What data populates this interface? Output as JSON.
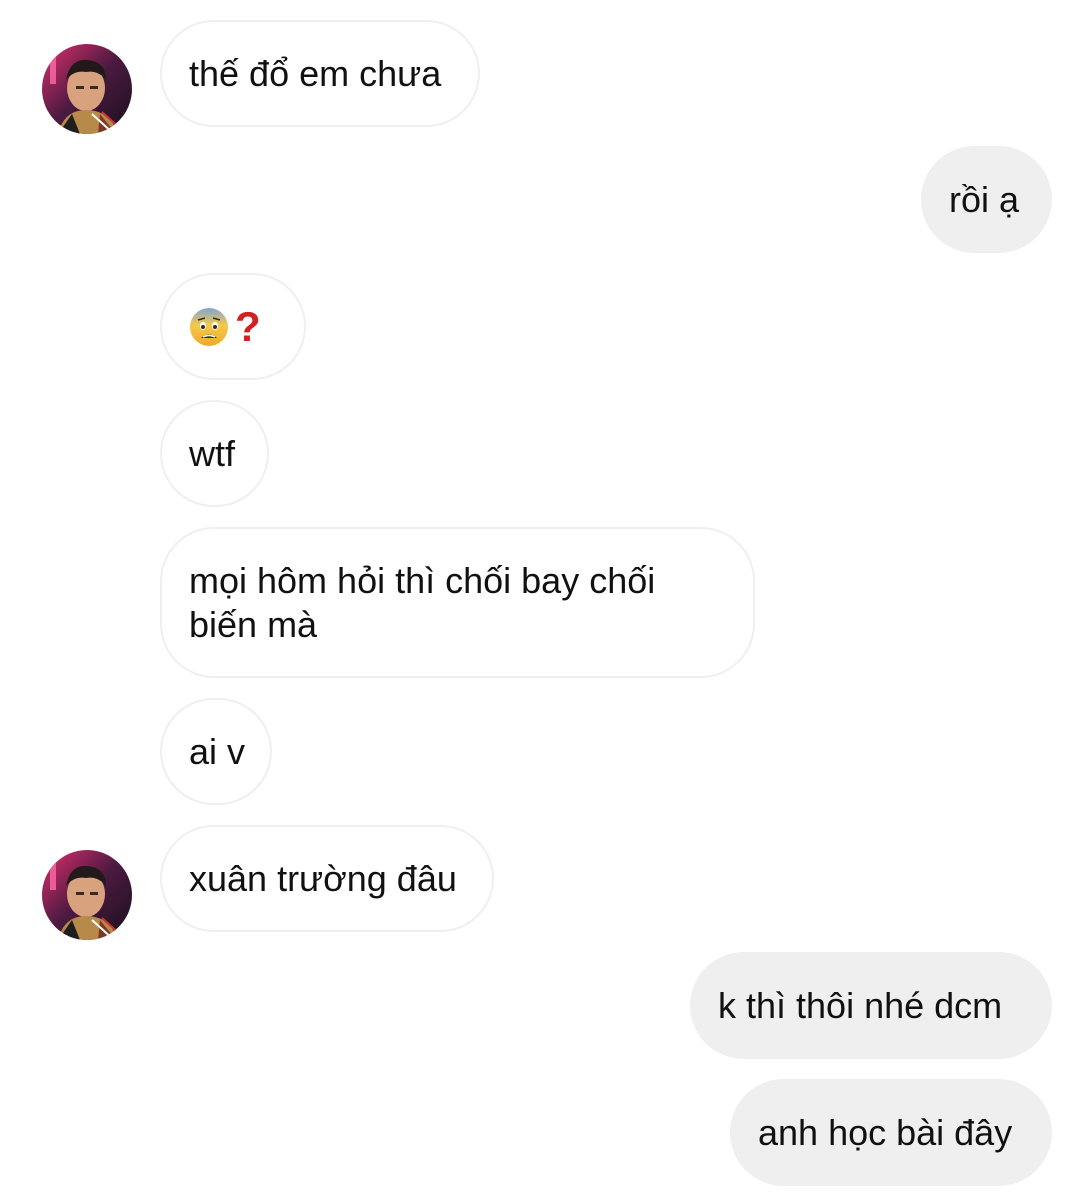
{
  "colors": {
    "background": "#ffffff",
    "incoming_bubble_bg": "#ffffff",
    "incoming_bubble_border": "#efefef",
    "outgoing_bubble_bg": "#efefef",
    "text": "#111111"
  },
  "messages": [
    {
      "direction": "incoming",
      "text": "thế đổ em chưa",
      "has_avatar": true
    },
    {
      "direction": "outgoing",
      "text": "rồi ạ"
    },
    {
      "direction": "incoming",
      "text": "",
      "icons": [
        "anxious-face-emoji",
        "red-question-mark-emoji"
      ]
    },
    {
      "direction": "incoming",
      "text": "wtf"
    },
    {
      "direction": "incoming",
      "text": "mọi hôm hỏi thì chối bay chối biến mà"
    },
    {
      "direction": "incoming",
      "text": "ai v"
    },
    {
      "direction": "incoming",
      "text": "xuân trường đâu",
      "has_avatar": true
    },
    {
      "direction": "outgoing",
      "text": "k thì thôi nhé dcm"
    },
    {
      "direction": "outgoing",
      "text": "anh học bài đây"
    }
  ]
}
